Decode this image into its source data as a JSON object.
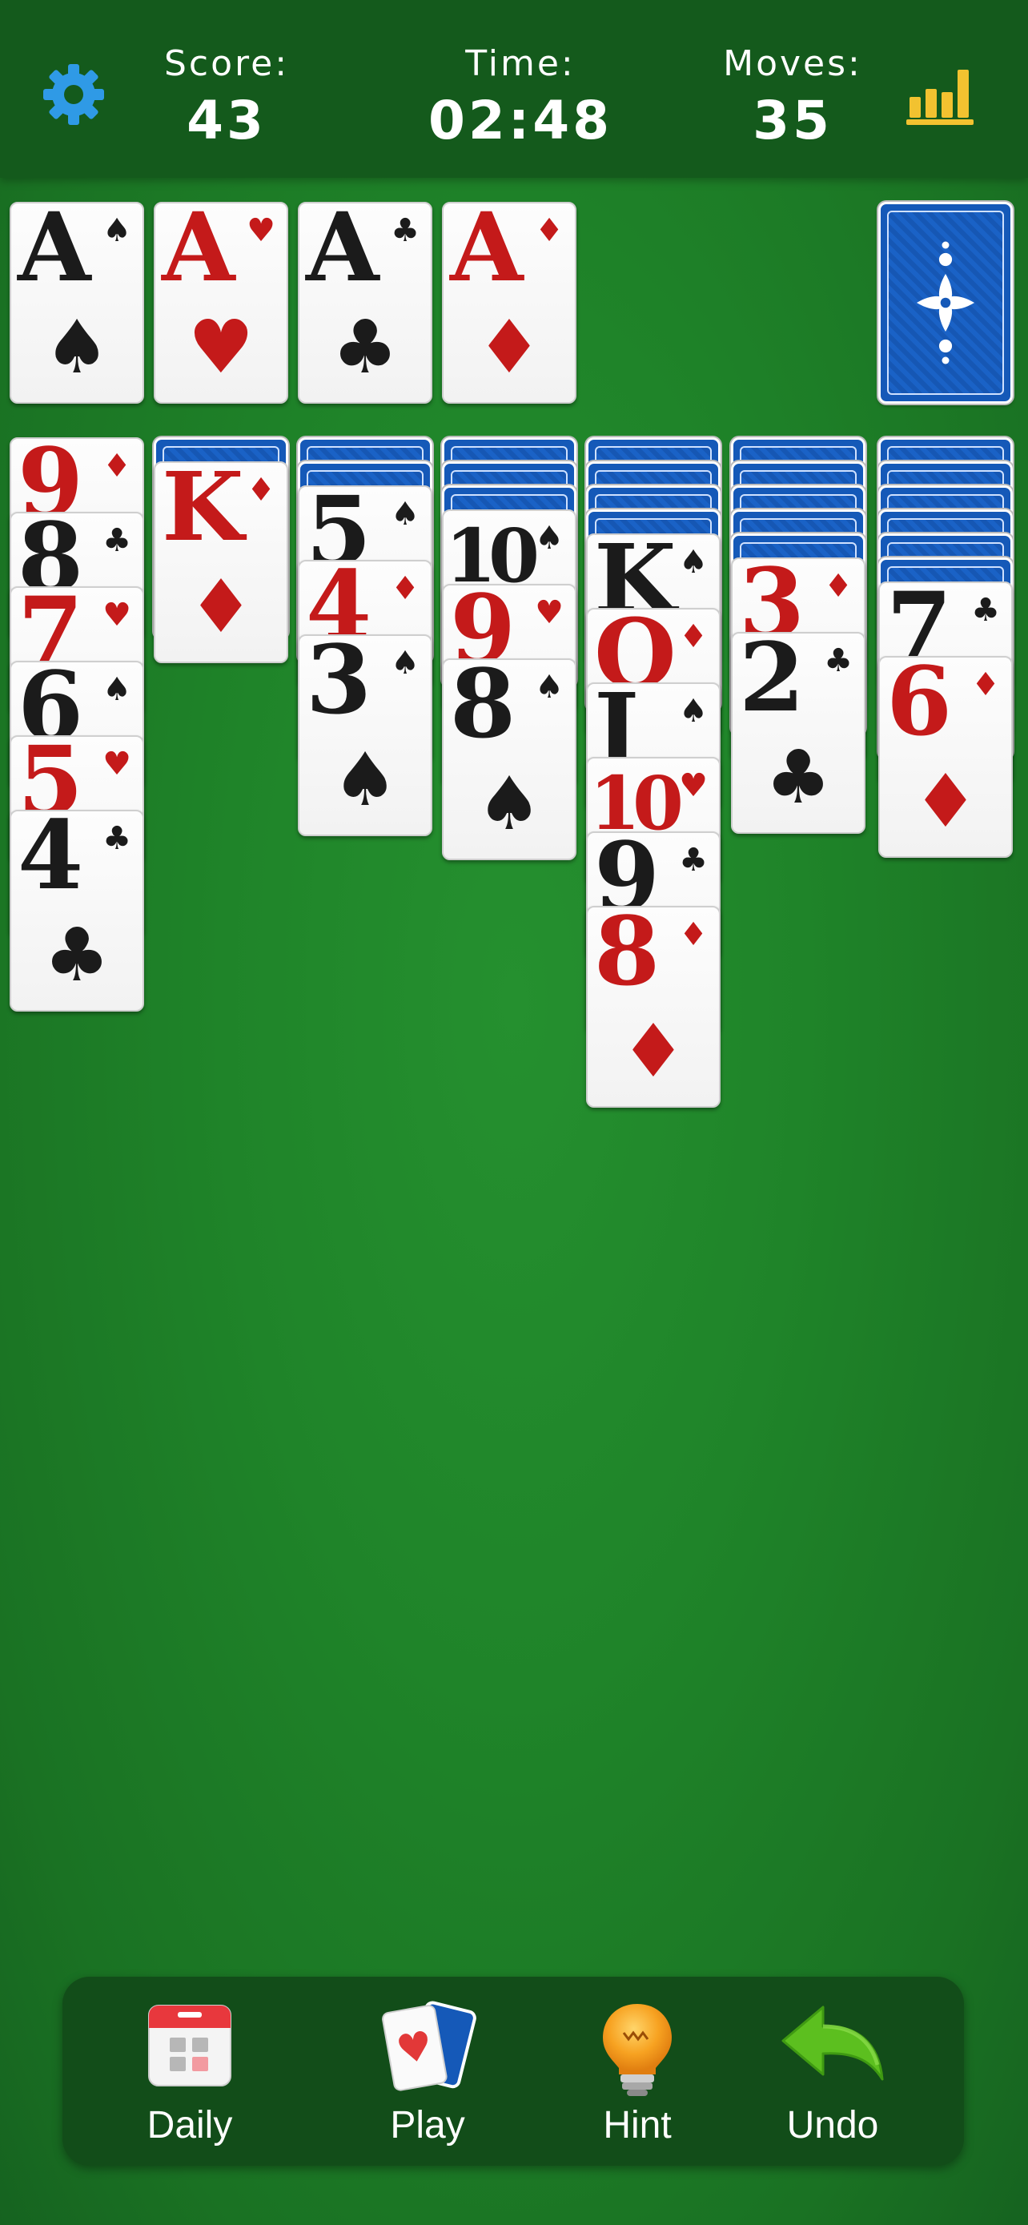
{
  "header": {
    "settings_icon": "gear-icon",
    "score_label": "Score:",
    "score_value": "43",
    "time_label": "Time:",
    "time_value": "02:48",
    "moves_label": "Moves:",
    "moves_value": "35",
    "stats_icon": "bar-chart-icon"
  },
  "foundations": [
    {
      "rank": "A",
      "suit": "♠",
      "color": "black"
    },
    {
      "rank": "A",
      "suit": "♥",
      "color": "red"
    },
    {
      "rank": "A",
      "suit": "♣",
      "color": "black"
    },
    {
      "rank": "A",
      "suit": "♦",
      "color": "red"
    }
  ],
  "stock": {
    "face": "down",
    "icon": "card-back-icon"
  },
  "tableau": [
    {
      "hidden": 0,
      "cards": [
        {
          "rank": "9",
          "suit": "♦",
          "color": "red"
        },
        {
          "rank": "8",
          "suit": "♣",
          "color": "black"
        },
        {
          "rank": "7",
          "suit": "♥",
          "color": "red"
        },
        {
          "rank": "6",
          "suit": "♠",
          "color": "black"
        },
        {
          "rank": "5",
          "suit": "♥",
          "color": "red"
        },
        {
          "rank": "4",
          "suit": "♣",
          "color": "black"
        }
      ]
    },
    {
      "hidden": 1,
      "cards": [
        {
          "rank": "K",
          "suit": "♦",
          "color": "red"
        }
      ]
    },
    {
      "hidden": 2,
      "cards": [
        {
          "rank": "5",
          "suit": "♠",
          "color": "black"
        },
        {
          "rank": "4",
          "suit": "♦",
          "color": "red"
        },
        {
          "rank": "3",
          "suit": "♠",
          "color": "black"
        }
      ]
    },
    {
      "hidden": 3,
      "cards": [
        {
          "rank": "10",
          "suit": "♠",
          "color": "black"
        },
        {
          "rank": "9",
          "suit": "♥",
          "color": "red"
        },
        {
          "rank": "8",
          "suit": "♠",
          "color": "black"
        }
      ]
    },
    {
      "hidden": 4,
      "cards": [
        {
          "rank": "K",
          "suit": "♠",
          "color": "black"
        },
        {
          "rank": "Q",
          "suit": "♦",
          "color": "red"
        },
        {
          "rank": "J",
          "suit": "♠",
          "color": "black"
        },
        {
          "rank": "10",
          "suit": "♥",
          "color": "red"
        },
        {
          "rank": "9",
          "suit": "♣",
          "color": "black"
        },
        {
          "rank": "8",
          "suit": "♦",
          "color": "red"
        }
      ]
    },
    {
      "hidden": 5,
      "cards": [
        {
          "rank": "3",
          "suit": "♦",
          "color": "red"
        },
        {
          "rank": "2",
          "suit": "♣",
          "color": "black"
        }
      ]
    },
    {
      "hidden": 6,
      "cards": [
        {
          "rank": "7",
          "suit": "♣",
          "color": "black"
        },
        {
          "rank": "6",
          "suit": "♦",
          "color": "red"
        }
      ]
    }
  ],
  "bottom_bar": {
    "daily_label": "Daily",
    "play_label": "Play",
    "hint_label": "Hint",
    "undo_label": "Undo"
  },
  "colors": {
    "felt": "#1f8429",
    "header": "#145a1c",
    "red_suit": "#c41a1a",
    "black_suit": "#1b1b1b",
    "card_back": "#1559b8",
    "stats_icon": "#f2c230",
    "gear_icon": "#2f9ae6"
  }
}
